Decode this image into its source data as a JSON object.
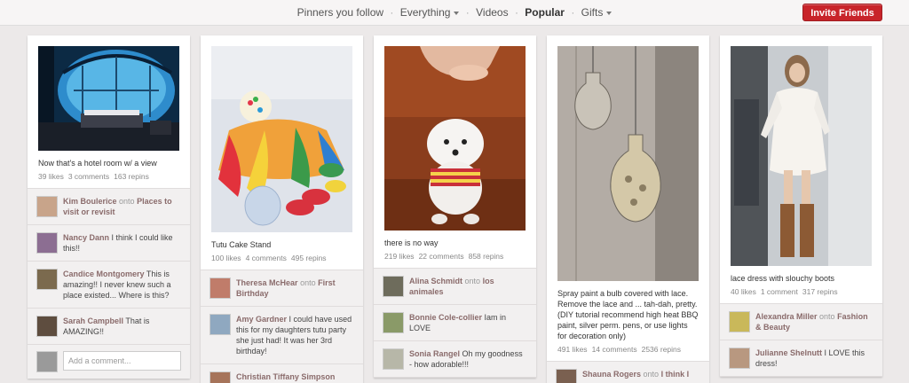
{
  "nav": {
    "pinners": "Pinners you follow",
    "everything": "Everything",
    "videos": "Videos",
    "popular": "Popular",
    "gifts": "Gifts",
    "sep": "·"
  },
  "invite_label": "Invite Friends",
  "pins": [
    {
      "description": "Now that's a hotel room w/ a view",
      "likes": "39 likes",
      "comments": "3 comments",
      "repins": "163 repins",
      "comment_list": [
        {
          "name": "Kim Boulerice",
          "onto": "onto",
          "board": "Places to visit or revisit",
          "text": ""
        },
        {
          "name": "Nancy Dann",
          "onto": "",
          "board": "",
          "text": "I think I could like this!!"
        },
        {
          "name": "Candice Montgomery",
          "onto": "",
          "board": "",
          "text": "This is amazing!! I never knew such a place existed... Where is this?"
        },
        {
          "name": "Sarah Campbell",
          "onto": "",
          "board": "",
          "text": "That is AMAZING!!"
        }
      ],
      "add_comment_placeholder": "Add a comment..."
    },
    {
      "description": "Tutu Cake Stand",
      "likes": "100 likes",
      "comments": "4 comments",
      "repins": "495 repins",
      "comment_list": [
        {
          "name": "Theresa McHear",
          "onto": "onto",
          "board": "First Birthday",
          "text": ""
        },
        {
          "name": "Amy Gardner",
          "onto": "",
          "board": "",
          "text": "I could have used this for my daughters tutu party she just had! It was her 3rd birthday!"
        },
        {
          "name": "Christian Tiffany Simpson",
          "onto": "",
          "board": "",
          "text": ""
        }
      ]
    },
    {
      "description": "there is no way",
      "likes": "219 likes",
      "comments": "22 comments",
      "repins": "858 repins",
      "comment_list": [
        {
          "name": "Alina Schmidt",
          "onto": "onto",
          "board": "los animales",
          "text": ""
        },
        {
          "name": "Bonnie Cole-collier",
          "onto": "",
          "board": "",
          "text": "Iam in LOVE"
        },
        {
          "name": "Sonia Rangel",
          "onto": "",
          "board": "",
          "text": "Oh my goodness - how adorable!!!"
        }
      ]
    },
    {
      "description": "Spray paint a bulb covered with lace. Remove the lace and ... tah-dah, pretty. (DIY tutorial recommend high heat BBQ paint, silver perm. pens, or use lights for decoration only)",
      "likes": "491 likes",
      "comments": "14 comments",
      "repins": "2536 repins",
      "comment_list": [
        {
          "name": "Shauna Rogers",
          "onto": "onto",
          "board": "I think I",
          "text": ""
        }
      ]
    },
    {
      "description": "lace dress with slouchy boots",
      "likes": "40 likes",
      "comments": "1 comment",
      "repins": "317 repins",
      "comment_list": [
        {
          "name": "Alexandra Miller",
          "onto": "onto",
          "board": "Fashion & Beauty",
          "text": ""
        },
        {
          "name": "Julianne Shelnutt",
          "onto": "",
          "board": "",
          "text": "I LOVE this dress!"
        }
      ]
    }
  ]
}
